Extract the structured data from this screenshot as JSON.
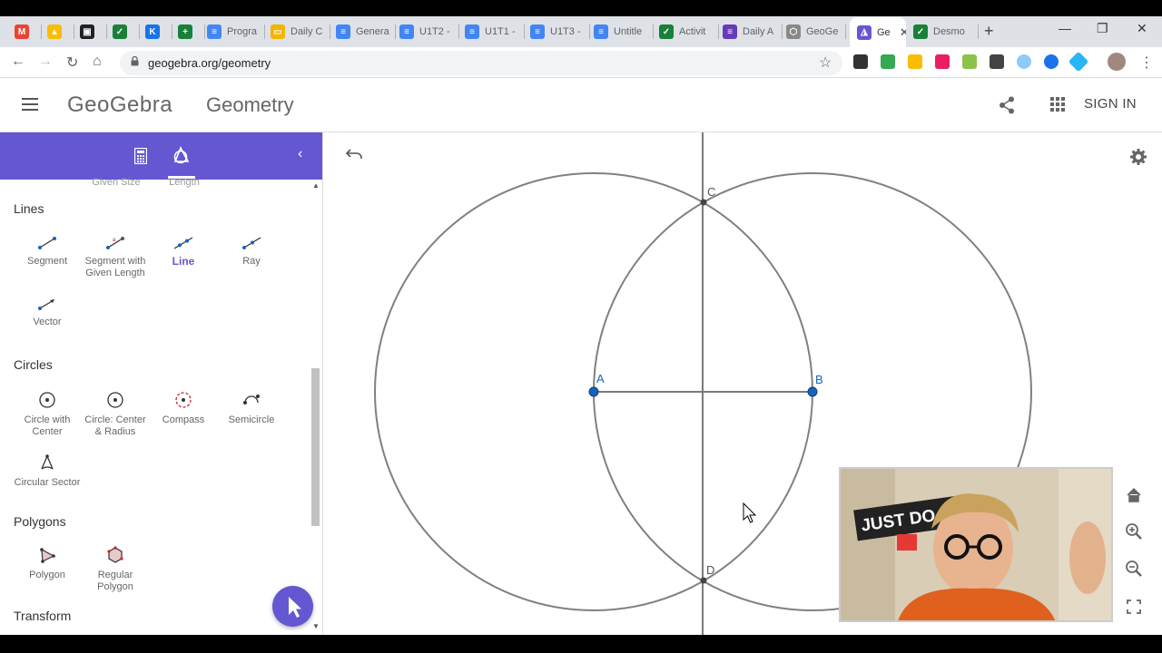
{
  "browser": {
    "tabs": [
      {
        "label": "",
        "icon": "gmail-icon",
        "color": "#ea4335",
        "glyph": "M"
      },
      {
        "label": "",
        "icon": "drive-icon",
        "color": "#fbbc04",
        "glyph": "▲"
      },
      {
        "label": "",
        "icon": "classroom-icon",
        "color": "#202124",
        "glyph": "▣"
      },
      {
        "label": "",
        "icon": "sheets-icon",
        "color": "#188038",
        "glyph": "✓"
      },
      {
        "label": "",
        "icon": "k-app-icon",
        "color": "#1a73e8",
        "glyph": "K"
      },
      {
        "label": "",
        "icon": "plus-app-icon",
        "color": "#188038",
        "glyph": "+"
      },
      {
        "label": "Progra",
        "icon": "docs-icon",
        "color": "#4285f4",
        "glyph": "≡"
      },
      {
        "label": "Daily C",
        "icon": "slides-icon",
        "color": "#f4b400",
        "glyph": "▭"
      },
      {
        "label": "Genera",
        "icon": "docs-icon",
        "color": "#4285f4",
        "glyph": "≡"
      },
      {
        "label": "U1T2 -",
        "icon": "docs-icon",
        "color": "#4285f4",
        "glyph": "≡"
      },
      {
        "label": "U1T1 -",
        "icon": "docs-icon",
        "color": "#4285f4",
        "glyph": "≡"
      },
      {
        "label": "U1T3 -",
        "icon": "docs-icon",
        "color": "#4285f4",
        "glyph": "≡"
      },
      {
        "label": "Untitle",
        "icon": "docs-icon",
        "color": "#4285f4",
        "glyph": "≡"
      },
      {
        "label": "Activit",
        "icon": "desmos-icon",
        "color": "#188038",
        "glyph": "✓"
      },
      {
        "label": "Daily A",
        "icon": "forms-icon",
        "color": "#673ab7",
        "glyph": "≡"
      },
      {
        "label": "GeoGe",
        "icon": "geogebra-icon",
        "color": "#888888",
        "glyph": "⬡"
      },
      {
        "label": "Ge",
        "icon": "geogebra-icon",
        "color": "#6557d2",
        "glyph": "◮",
        "active": true
      },
      {
        "label": "Desmo",
        "icon": "desmos-icon",
        "color": "#188038",
        "glyph": "✓"
      }
    ],
    "url": "geogebra.org/geometry"
  },
  "header": {
    "logo": "GeoGebra",
    "app_name": "Geometry",
    "signin": "SIGN IN"
  },
  "panel": {
    "clipped_tools": [
      "Given Size",
      "Length"
    ],
    "sections": [
      {
        "title": "Lines",
        "tools": [
          {
            "label": "Segment",
            "icon": "segment-tool-icon"
          },
          {
            "label": "Segment with Given Length",
            "icon": "segment-given-length-tool-icon"
          },
          {
            "label": "Line",
            "icon": "line-tool-icon",
            "active": true
          },
          {
            "label": "Ray",
            "icon": "ray-tool-icon"
          },
          {
            "label": "Vector",
            "icon": "vector-tool-icon"
          }
        ]
      },
      {
        "title": "Circles",
        "tools": [
          {
            "label": "Circle with Center",
            "icon": "circle-center-tool-icon"
          },
          {
            "label": "Circle: Center & Radius",
            "icon": "circle-center-radius-tool-icon"
          },
          {
            "label": "Compass",
            "icon": "compass-tool-icon"
          },
          {
            "label": "Semicircle",
            "icon": "semicircle-tool-icon"
          },
          {
            "label": "Circular Sector",
            "icon": "circular-sector-tool-icon"
          }
        ]
      },
      {
        "title": "Polygons",
        "tools": [
          {
            "label": "Polygon",
            "icon": "polygon-tool-icon"
          },
          {
            "label": "Regular Polygon",
            "icon": "regular-polygon-tool-icon"
          }
        ]
      },
      {
        "title": "Transform",
        "tools": []
      }
    ]
  },
  "graphics": {
    "points": [
      {
        "label": "A",
        "color": "#1565c0"
      },
      {
        "label": "B",
        "color": "#1565c0"
      },
      {
        "label": "C",
        "color": "#555555"
      },
      {
        "label": "D",
        "color": "#555555"
      }
    ]
  },
  "webcam": {
    "sign_text": "JUST DO IT"
  },
  "colors": {
    "accent": "#6557d2",
    "point_blue": "#1565c0",
    "construction_gray": "#808080"
  }
}
